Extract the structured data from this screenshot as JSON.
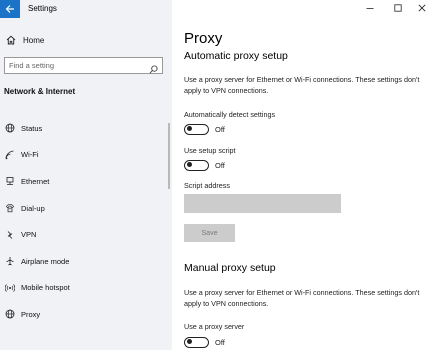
{
  "window": {
    "title": "Settings"
  },
  "sidebar": {
    "home_label": "Home",
    "search_placeholder": "Find a setting",
    "section_title": "Network & Internet",
    "items": [
      {
        "label": "Status",
        "icon": "globe-icon"
      },
      {
        "label": "Wi-Fi",
        "icon": "wifi-icon"
      },
      {
        "label": "Ethernet",
        "icon": "ethernet-icon"
      },
      {
        "label": "Dial-up",
        "icon": "dialup-icon"
      },
      {
        "label": "VPN",
        "icon": "vpn-icon"
      },
      {
        "label": "Airplane mode",
        "icon": "airplane-icon"
      },
      {
        "label": "Mobile hotspot",
        "icon": "hotspot-icon"
      },
      {
        "label": "Proxy",
        "icon": "globe-icon"
      }
    ]
  },
  "main": {
    "title": "Proxy",
    "automatic": {
      "heading": "Automatic proxy setup",
      "description": "Use a proxy server for Ethernet or Wi-Fi connections. These settings don't apply to VPN connections.",
      "detect_label": "Automatically detect settings",
      "detect_state": "Off",
      "script_label": "Use setup script",
      "script_state": "Off",
      "address_label": "Script address",
      "address_value": "",
      "save_label": "Save"
    },
    "manual": {
      "heading": "Manual proxy setup",
      "description": "Use a proxy server for Ethernet or Wi-Fi connections. These settings don't apply to VPN connections.",
      "proxy_label": "Use a proxy server",
      "proxy_state": "Off"
    }
  },
  "colors": {
    "accent": "#1a73c7",
    "sidebar_bg": "#f0f2f5",
    "disabled_bg": "#cccccc"
  }
}
